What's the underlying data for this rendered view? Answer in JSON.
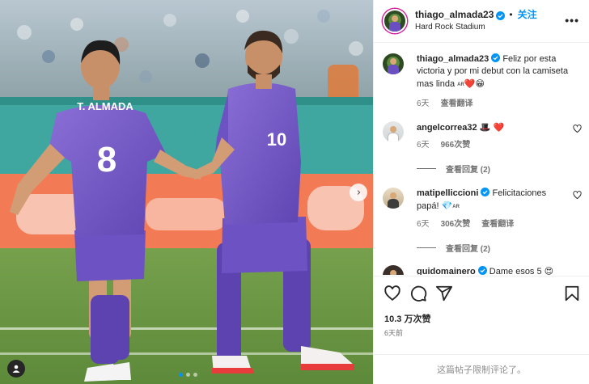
{
  "post": {
    "username": "thiago_almada23",
    "follow_label": "关注",
    "location": "Hard Rock Stadium",
    "more_label": "•••",
    "photo": {
      "player_left": {
        "name": "T. ALMADA",
        "number": "8"
      },
      "player_right": {
        "number": "10"
      },
      "carousel_count": 3,
      "carousel_active": 1
    }
  },
  "caption": {
    "username": "thiago_almada23",
    "text": "Feliz por esta victoria y por mi debut con la camiseta mas linda",
    "flag": "AR",
    "emojis": "❤️😁",
    "age": "6天",
    "translate": "查看翻译"
  },
  "comments": [
    {
      "username": "angelcorrea32",
      "text": "🎩 ❤️",
      "age": "6天",
      "likes": "966次赞",
      "translate": "",
      "replies": "查看回复 (2)"
    },
    {
      "username": "matipelliccioni",
      "text": "Felicitaciones papá!",
      "emoji": "💎",
      "flag": "AR",
      "age": "6天",
      "likes": "306次赞",
      "translate": "查看翻译",
      "replies": "查看回复 (2)"
    },
    {
      "username": "guidomainero",
      "text": "Dame esos 5",
      "emoji": "😍"
    }
  ],
  "actions": {
    "likes": "10.3 万次赞",
    "time": "6天前"
  },
  "footer": {
    "text": "这篇帖子限制评论了。"
  },
  "colors": {
    "jersey": "#7a5cc9",
    "link": "#0095f6",
    "muted": "#737373"
  },
  "icons": [
    "verified-badge-icon",
    "heart-icon",
    "comment-icon",
    "share-icon",
    "bookmark-icon",
    "tag-user-icon",
    "chevron-right-icon",
    "more-icon"
  ]
}
